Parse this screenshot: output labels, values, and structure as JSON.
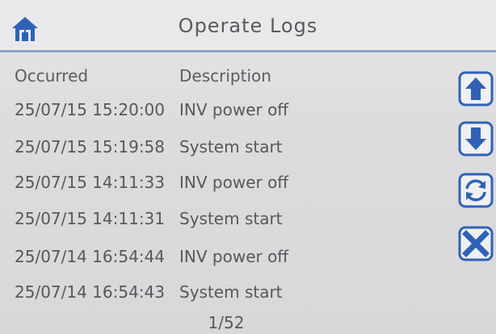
{
  "header": {
    "title": "Operate Logs",
    "home_icon": "home-icon"
  },
  "table": {
    "columns": [
      "Occurred",
      "Description"
    ],
    "rows": [
      {
        "occurred": "25/07/15 15:20:00",
        "description": "INV power off"
      },
      {
        "occurred": "25/07/15 15:19:58",
        "description": "System start"
      },
      {
        "occurred": "25/07/15 14:11:33",
        "description": "INV power off"
      },
      {
        "occurred": "25/07/15 14:11:31",
        "description": "System start"
      },
      {
        "occurred": "25/07/14 16:54:44",
        "description": "INV power off"
      },
      {
        "occurred": "25/07/14 16:54:43",
        "description": "System start"
      }
    ]
  },
  "pager": {
    "text": "1/52"
  },
  "side_buttons": {
    "up_icon": "arrow-up-icon",
    "down_icon": "arrow-down-icon",
    "refresh_icon": "refresh-icon",
    "close_icon": "close-icon"
  },
  "colors": {
    "accent": "#2f62b5",
    "text": "#58585c",
    "underline": "#8aa3c8"
  }
}
